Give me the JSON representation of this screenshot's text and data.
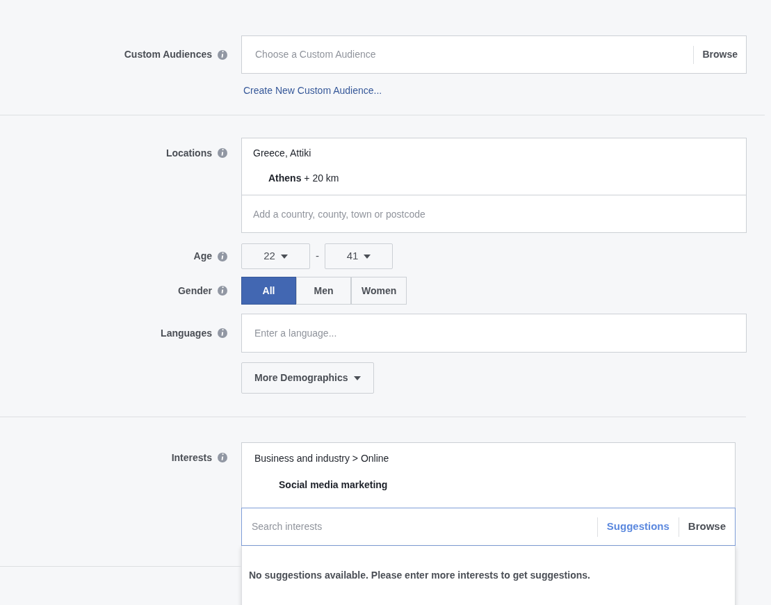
{
  "custom_audiences": {
    "label": "Custom Audiences",
    "placeholder": "Choose a Custom Audience",
    "browse": "Browse",
    "link": "Create New Custom Audience..."
  },
  "locations": {
    "label": "Locations",
    "group": "Greece, Attiki",
    "item": "**Athens** + 20 km",
    "placeholder": "Add a country, county, town or postcode"
  },
  "age": {
    "label": "Age",
    "min": "22",
    "separator": "-",
    "max": "41"
  },
  "gender": {
    "label": "Gender",
    "options": [
      {
        "label": "All",
        "selected": true
      },
      {
        "label": "Men",
        "selected": false
      },
      {
        "label": "Women",
        "selected": false
      }
    ]
  },
  "languages": {
    "label": "Languages",
    "placeholder": "Enter a language..."
  },
  "more_demographics": "More Demographics",
  "interests": {
    "label": "Interests",
    "path": "Business and industry > Online",
    "item": "Social media marketing",
    "placeholder": "Search interests",
    "tabs": [
      {
        "label": "Suggestions",
        "selected": true
      },
      {
        "label": "Browse",
        "selected": false
      }
    ],
    "message": "No suggestions available. Please enter more interests to get suggestions."
  }
}
